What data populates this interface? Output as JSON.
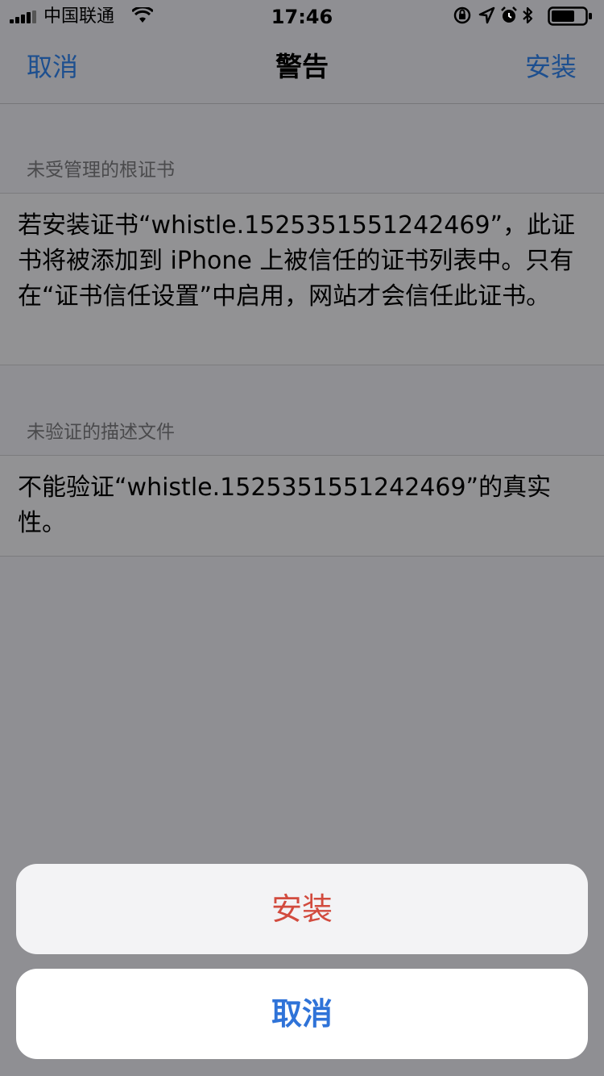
{
  "status_bar": {
    "carrier": "中国联通",
    "time": "17:46",
    "icons": [
      "signal-icon",
      "wifi-icon",
      "orientation-lock-icon",
      "location-icon",
      "alarm-icon",
      "bluetooth-icon",
      "battery-icon"
    ]
  },
  "nav": {
    "left_label": "取消",
    "title": "警告",
    "right_label": "安装"
  },
  "sections": [
    {
      "header": "未受管理的根证书",
      "body": "若安装证书“whistle.1525351551242469”，此证书将被添加到 iPhone 上被信任的证书列表中。只有在“证书信任设置”中启用，网站才会信任此证书。"
    },
    {
      "header": "未验证的描述文件",
      "body": "不能验证“whistle.1525351551242469”的真实性。"
    }
  ],
  "action_sheet": {
    "install_label": "安装",
    "cancel_label": "取消"
  },
  "colors": {
    "overlay": "#8f8f93",
    "nav_link": "#1d4f8f",
    "destructive": "#d24b3e",
    "cancel": "#2f73d8"
  }
}
